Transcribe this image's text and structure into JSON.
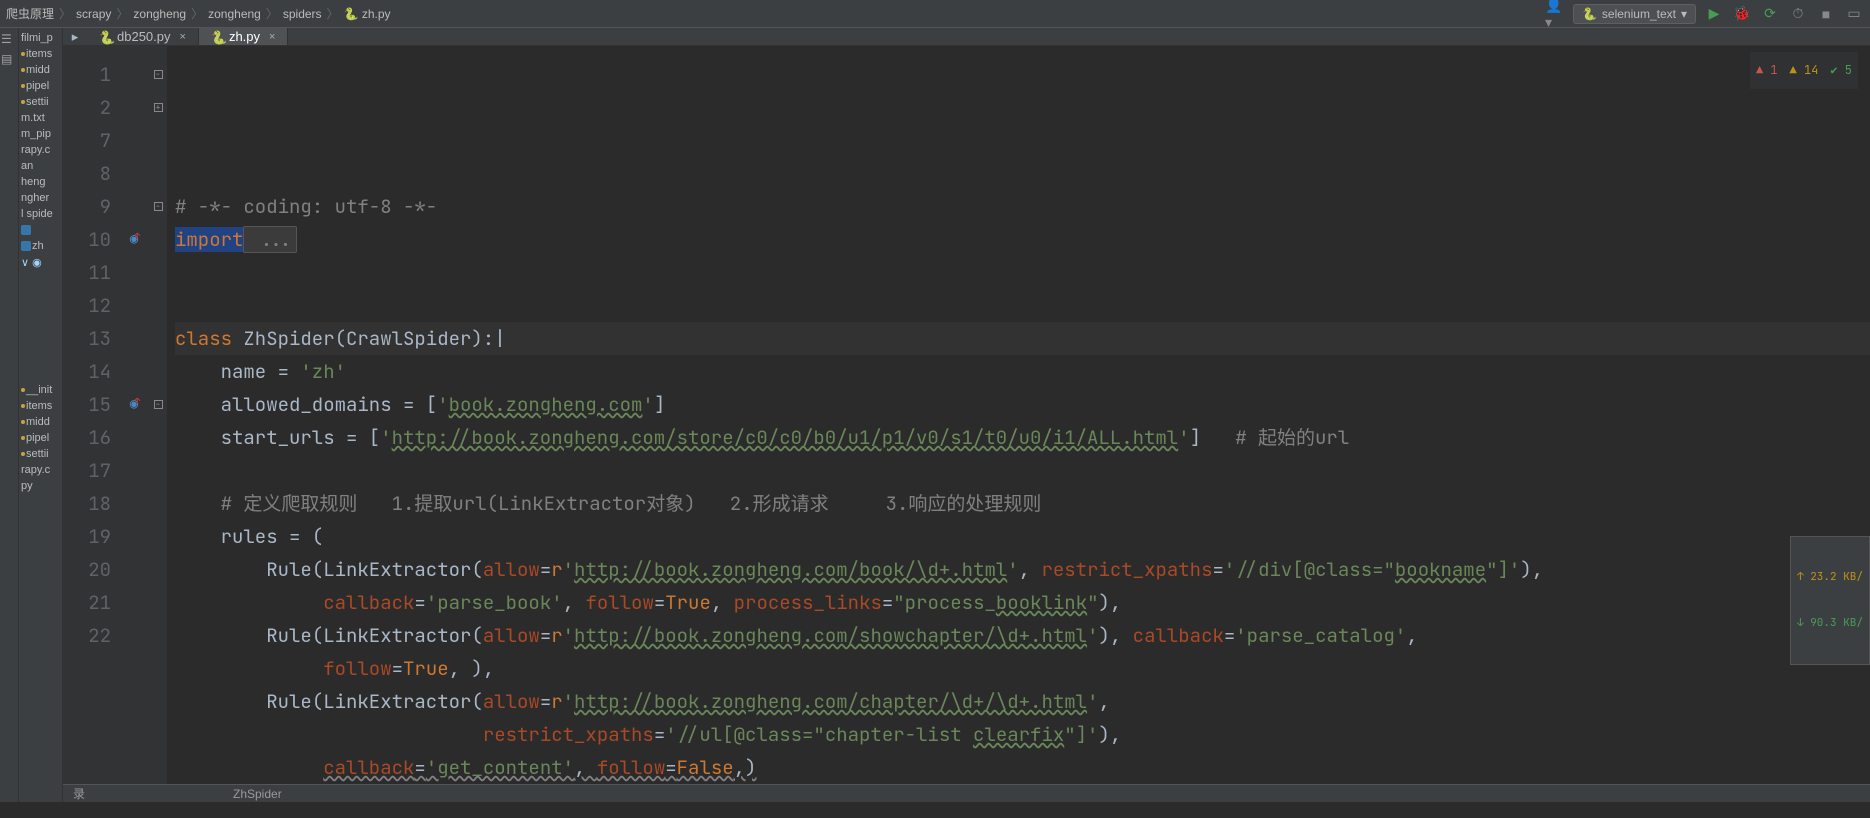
{
  "breadcrumbs": [
    "爬虫原理",
    "scrapy",
    "zongheng",
    "zongheng",
    "spiders",
    "zh.py"
  ],
  "run_config": "selenium_text",
  "tabs": [
    {
      "label": "db250.py",
      "active": false
    },
    {
      "label": "zh.py",
      "active": true
    }
  ],
  "project_tree": {
    "items": [
      {
        "t": "filmi_p",
        "k": "txt"
      },
      {
        "t": "items",
        "k": "dot"
      },
      {
        "t": "midd",
        "k": "dot"
      },
      {
        "t": "pipel",
        "k": "dot"
      },
      {
        "t": "settii",
        "k": "dot"
      },
      {
        "t": "m.txt",
        "k": "txt"
      },
      {
        "t": "m_pip",
        "k": "txt"
      },
      {
        "t": "rapy.c",
        "k": "txt"
      },
      {
        "t": "an",
        "k": "txt"
      },
      {
        "t": "heng",
        "k": "txt"
      },
      {
        "t": "ngher",
        "k": "txt"
      },
      {
        "t": "l spide",
        "k": "txt"
      },
      {
        "t": "",
        "k": "py"
      },
      {
        "t": "zh",
        "k": "py"
      },
      {
        "t": "",
        "k": "chev"
      },
      {
        "t": "",
        "k": "sp"
      },
      {
        "t": "",
        "k": "sp"
      },
      {
        "t": "",
        "k": "sp"
      },
      {
        "t": "",
        "k": "sp"
      },
      {
        "t": "",
        "k": "sp"
      },
      {
        "t": "",
        "k": "sp"
      },
      {
        "t": "",
        "k": "sp"
      },
      {
        "t": "__init",
        "k": "dot"
      },
      {
        "t": "items",
        "k": "dot"
      },
      {
        "t": "midd",
        "k": "dot"
      },
      {
        "t": "pipel",
        "k": "dot"
      },
      {
        "t": "settii",
        "k": "dot"
      },
      {
        "t": "rapy.c",
        "k": "txt"
      },
      {
        "t": "py",
        "k": "txt"
      }
    ]
  },
  "code": {
    "start": 1,
    "lines": [
      {
        "n": 1,
        "fold": "-",
        "html": "<span class='com'># -*- coding: utf-8 -*-</span>"
      },
      {
        "n": 2,
        "fold": "+",
        "html": "<span class='kw sel-bg'>import</span><span class='fold-collapsed sel-bg'> ...</span>"
      },
      {
        "n": 7,
        "html": ""
      },
      {
        "n": 8,
        "html": ""
      },
      {
        "n": 9,
        "fold": "-",
        "html": "<span class='kw'>class </span><span class='def'>ZhSpider(CrawlSpider):</span><span class='caret'>|</span>",
        "hl": true
      },
      {
        "n": 10,
        "gi": "ov",
        "html": "    name = <span class='str'>'zh'</span>"
      },
      {
        "n": 11,
        "html": "    allowed_domains = [<span class='str'>'<span class='underl'>book.zongheng.com</span>'</span>]"
      },
      {
        "n": 12,
        "html": "    start_urls = [<span class='str'>'<span class='underl'>http://book.zongheng.com/store/c0/c0/b0/u1/p1/v0/s1/t0/u0/i1/ALL.html</span>'</span>]   <span class='com'># 起始的url</span>"
      },
      {
        "n": 13,
        "html": ""
      },
      {
        "n": 14,
        "html": "    <span class='com'># 定义爬取规则   1.提取url(LinkExtractor对象)   2.形成请求     3.响应的处理规则</span>"
      },
      {
        "n": 15,
        "gi": "ov",
        "fold": "-",
        "html": "    rules = ("
      },
      {
        "n": 16,
        "html": "        Rule(LinkExtractor(<span class='param'>allow</span>=<span class='kw'>r</span><span class='str'>'<span class='underl'>http://book.zongheng.com/book/\\d+.html</span>'</span>, <span class='param'>restrict_xpaths</span>=<span class='str'>'//div[@class=\"<span class='underl'>bookname</span>\"]'</span>),"
      },
      {
        "n": 17,
        "html": "             <span class='param'>callback</span>=<span class='str'>'parse_book'</span>, <span class='param'>follow</span>=<span class='bool'>True</span>, <span class='param'>process_links</span>=<span class='str'>\"process_<span class='underl'>booklink</span>\"</span>),"
      },
      {
        "n": 18,
        "html": "        Rule(LinkExtractor(<span class='param'>allow</span>=<span class='kw'>r</span><span class='str'>'<span class='underl'>http://book.zongheng.com/showchapter/\\d+.html</span>'</span>), <span class='param'>callback</span>=<span class='str'>'parse_catalog'</span>,"
      },
      {
        "n": 19,
        "html": "             <span class='param'>follow</span>=<span class='bool'>True</span>, ),"
      },
      {
        "n": 20,
        "html": "        Rule(LinkExtractor(<span class='param'>allow</span>=<span class='kw'>r</span><span class='str'>'<span class='underl'>http://book.zongheng.com/chapter/\\d+/\\d+.html</span>'</span>,"
      },
      {
        "n": 21,
        "html": "                           <span class='param'>restrict_xpaths</span>=<span class='str'>'//ul[@class=\"chapter-list <span class='underl'>clearfix</span>\"]'</span>),"
      },
      {
        "n": 22,
        "html": "             <span class='param underl-y'>callback</span><span class='underl-y'>=</span><span class='str underl-y'>'get_content'</span><span class='underl-y'>, </span><span class='param underl-y'>follow</span><span class='underl-y'>=</span><span class='bool underl-y'>False</span><span class='underl-y'>,)</span>"
      }
    ]
  },
  "inspection": {
    "err": 1,
    "warn": 14,
    "ok": 5
  },
  "net": {
    "up": "23.2 KB/",
    "down": "90.3 KB/"
  },
  "status_crumb": "ZhSpider",
  "status_left": "录"
}
